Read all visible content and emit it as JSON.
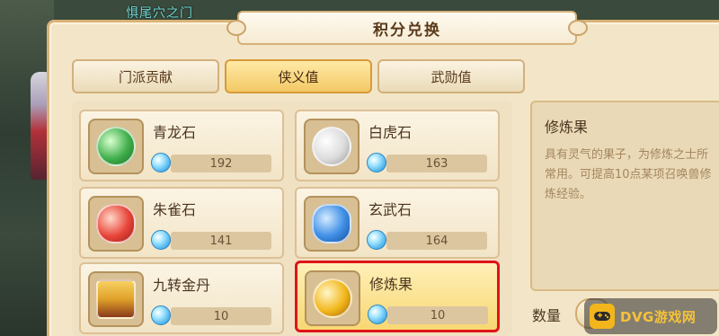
{
  "world": {
    "label": "惧尾穴之门"
  },
  "dialog": {
    "title": "积分兑换"
  },
  "tabs": [
    {
      "label": "门派贡献",
      "active": false
    },
    {
      "label": "侠义值",
      "active": true
    },
    {
      "label": "武勋值",
      "active": false
    }
  ],
  "items": [
    {
      "name": "青龙石",
      "price": "192",
      "icon": "green-dragon-stone-icon",
      "color": "#3fae4a"
    },
    {
      "name": "白虎石",
      "price": "163",
      "icon": "white-tiger-stone-icon",
      "color": "#e4e4e4"
    },
    {
      "name": "朱雀石",
      "price": "141",
      "icon": "vermilion-bird-stone-icon",
      "color": "#e8453a"
    },
    {
      "name": "玄武石",
      "price": "164",
      "icon": "black-tortoise-stone-icon",
      "color": "#3f8fe6"
    },
    {
      "name": "九转金丹",
      "price": "10",
      "icon": "golden-pill-chest-icon",
      "color": "#e0a12a"
    },
    {
      "name": "修炼果",
      "price": "10",
      "icon": "cultivation-fruit-icon",
      "color": "#f2b71b",
      "selected": true
    }
  ],
  "detail": {
    "name": "修炼果",
    "description": "具有灵气的果子，为修炼之士所常用。可提高10点某项召唤兽修炼经验。"
  },
  "quantity": {
    "label": "数量"
  },
  "watermark": {
    "text": "DVG游戏网"
  },
  "colors": {
    "selected_border": "#e0141a",
    "tab_active": "#f3c965"
  }
}
